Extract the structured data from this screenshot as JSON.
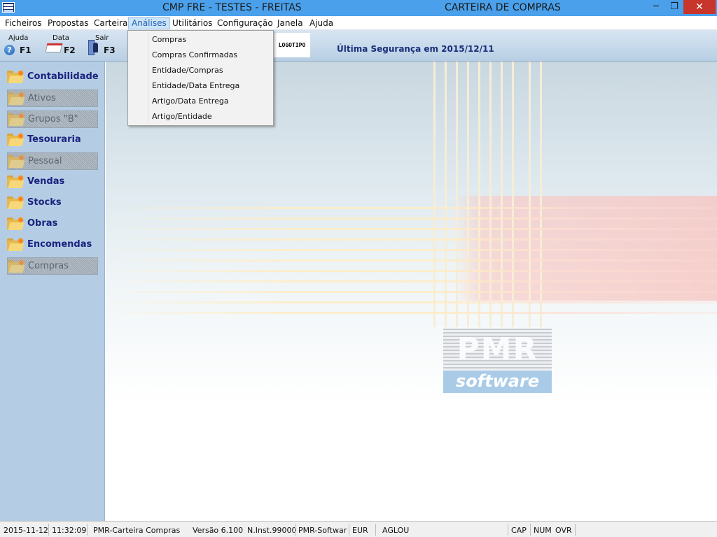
{
  "window": {
    "title": "CMP FRE - TESTES - FREITAS",
    "subtitle": "CARTEIRA DE COMPRAS",
    "minimize": "─",
    "maximize": "❐",
    "close": "✕"
  },
  "menubar": {
    "items": [
      "Ficheiros",
      "Propostas",
      "Carteira",
      "Análises",
      "Utilitários",
      "Configuração",
      "Janela",
      "Ajuda"
    ]
  },
  "toolbar": {
    "help_label": "Ajuda",
    "help_key": "F1",
    "date_label": "Data",
    "date_key": "F2",
    "exit_label": "Sair",
    "exit_key": "F3",
    "logo_text": "LOGOTIPO",
    "backup_text": "Última Segurança em   2015/12/11"
  },
  "dropdown": {
    "items": [
      "Compras",
      "Compras Confirmadas",
      "Entidade/Compras",
      "Entidade/Data Entrega",
      "Artigo/Data Entrega",
      "Artigo/Entidade"
    ]
  },
  "sidebar": {
    "items": [
      {
        "label": "Contabilidade",
        "enabled": true
      },
      {
        "label": "Ativos",
        "enabled": false
      },
      {
        "label": "Grupos \"B\"",
        "enabled": false
      },
      {
        "label": "Tesouraria",
        "enabled": true
      },
      {
        "label": "Pessoal",
        "enabled": false
      },
      {
        "label": "Vendas",
        "enabled": true
      },
      {
        "label": "Stocks",
        "enabled": true
      },
      {
        "label": "Obras",
        "enabled": true
      },
      {
        "label": "Encomendas",
        "enabled": true
      },
      {
        "label": "Compras",
        "enabled": false
      }
    ]
  },
  "logo": {
    "top": "PMR",
    "bottom": "software"
  },
  "statusbar": {
    "date": "2015-11-12",
    "time": "11:32:09",
    "module": "PMR-Carteira Compras",
    "version": "Versão  6.100",
    "install": "N.Inst.99000",
    "company": "PMR-Softwar",
    "currency": "EUR",
    "user": "AGLOU",
    "caps": "CAP",
    "num": "NUM",
    "ovr": "OVR"
  }
}
